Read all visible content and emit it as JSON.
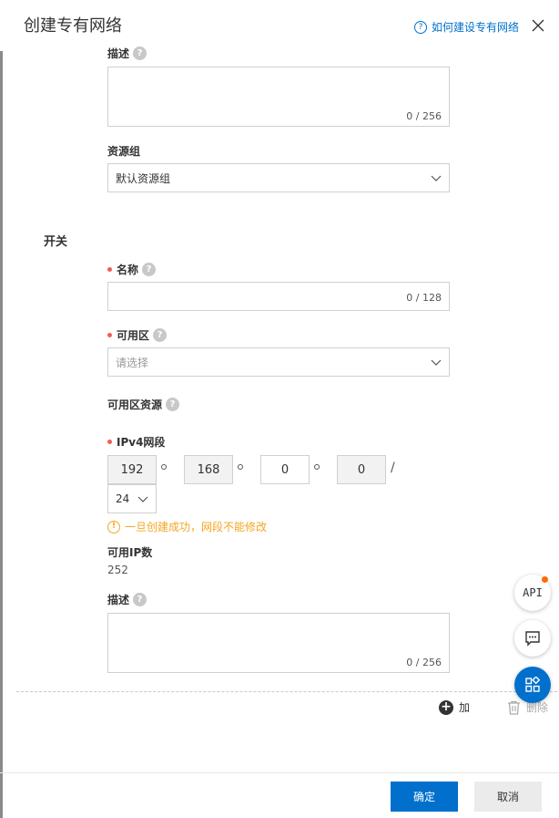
{
  "header": {
    "title": "创建专有网络",
    "help_link": "如何建设专有网络",
    "help_icon": "?"
  },
  "vpc": {
    "description_label": "描述",
    "description_counter": "0 / 256",
    "resource_group_label": "资源组",
    "resource_group_value": "默认资源组"
  },
  "switch": {
    "section_title": "开关",
    "name_label": "名称",
    "name_counter": "0 / 128",
    "zone_label": "可用区",
    "zone_placeholder": "请选择",
    "zone_resource_label": "可用区资源",
    "ipv4_label": "IPv4网段",
    "ip_octets": [
      "192",
      "168",
      "0",
      "0"
    ],
    "ip_slash": "/",
    "mask_value": "24",
    "warning_icon": "!",
    "warning_text": "一旦创建成功，网段不能修改",
    "available_ip_label": "可用IP数",
    "available_ip_value": "252",
    "description_label": "描述",
    "description_counter": "0 / 256",
    "add_label": "加",
    "delete_label": "删除"
  },
  "help_q": "?",
  "footer": {
    "confirm_label": "确定",
    "cancel_label": "取消"
  },
  "float_buttons": {
    "api_label": "API"
  },
  "colors": {
    "primary": "#0070cc",
    "required_dot": "#f25c54",
    "warning": "#f5a623",
    "badge": "#ff6a00"
  },
  "icons": [
    "help-circle-icon",
    "close-icon",
    "chevron-down-icon",
    "warning-icon",
    "add-circle-icon",
    "trash-icon",
    "chat-icon",
    "grid-apps-icon"
  ]
}
